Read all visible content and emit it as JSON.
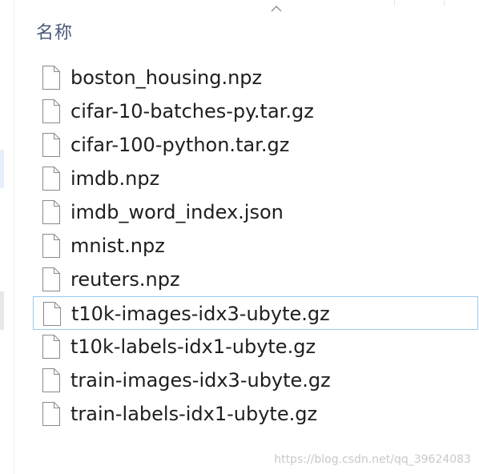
{
  "header": {
    "column_name": "名称",
    "sort_icon": "chevron-up-icon"
  },
  "files": [
    {
      "name": "boston_housing.npz",
      "icon": "file-icon"
    },
    {
      "name": "cifar-10-batches-py.tar.gz",
      "icon": "file-icon"
    },
    {
      "name": "cifar-100-python.tar.gz",
      "icon": "file-icon"
    },
    {
      "name": "imdb.npz",
      "icon": "file-icon"
    },
    {
      "name": "imdb_word_index.json",
      "icon": "file-icon"
    },
    {
      "name": "mnist.npz",
      "icon": "file-icon"
    },
    {
      "name": "reuters.npz",
      "icon": "file-icon"
    },
    {
      "name": "t10k-images-idx3-ubyte.gz",
      "icon": "file-icon",
      "focused": true
    },
    {
      "name": "t10k-labels-idx1-ubyte.gz",
      "icon": "file-icon"
    },
    {
      "name": "train-images-idx3-ubyte.gz",
      "icon": "file-icon"
    },
    {
      "name": "train-labels-idx1-ubyte.gz",
      "icon": "file-icon"
    }
  ],
  "watermark": "https://blog.csdn.net/qq_39624083",
  "colors": {
    "text": "#1e1e1e",
    "header_text": "#4a5a7a",
    "focus_border": "#99c9ef"
  }
}
